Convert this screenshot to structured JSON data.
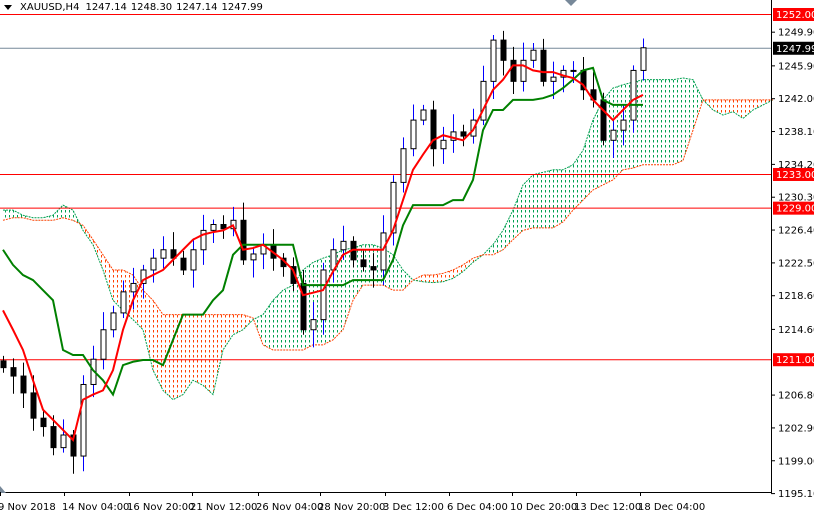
{
  "header": {
    "symbol": "XAUUSD,H4",
    "open": "1247.14",
    "high": "1248.30",
    "low": "1247.14",
    "close": "1247.99"
  },
  "colors": {
    "level": "#ff0000",
    "tenkan": "#ff0000",
    "kijun": "#008000",
    "cloud_bull": "#00a050",
    "cloud_bear": "#ff4000",
    "bid_line": "#778899",
    "bid_label": "#000000",
    "wick_up": "#0000ff"
  },
  "chart_data": {
    "type": "candlestick",
    "title": "XAUUSD,H4",
    "ylim": [
      1195.1,
      1254.0
    ],
    "yticks": [
      "1249.90",
      "1245.90",
      "1242.00",
      "1238.10",
      "1234.20",
      "1230.30",
      "1226.40",
      "1222.50",
      "1218.60",
      "1214.60",
      "1206.80",
      "1202.90",
      "1199.00",
      "1195.10"
    ],
    "xticks": [
      "9 Nov 2018",
      "14 Nov 04:00",
      "16 Nov 20:00",
      "21 Nov 12:00",
      "26 Nov 04:00",
      "28 Nov 20:00",
      "3 Dec 12:00",
      "6 Dec 04:00",
      "10 Dec 20:00",
      "13 Dec 12:00",
      "18 Dec 04:00"
    ],
    "levels": [
      {
        "price": 1252.0,
        "label": "1252.00"
      },
      {
        "price": 1233.0,
        "label": "1233.00"
      },
      {
        "price": 1229.0,
        "label": "1229.00"
      },
      {
        "price": 1211.0,
        "label": "1211.00"
      }
    ],
    "bid": {
      "price": 1247.99,
      "label": "1247.99"
    },
    "close": [
      1210,
      1209,
      1207,
      1204,
      1203,
      1200.5,
      1202,
      1199.5,
      1208,
      1211,
      1214.5,
      1216.5,
      1219,
      1220,
      1221.6,
      1223,
      1224,
      1223,
      1221.6,
      1224,
      1226.3,
      1227,
      1226.5,
      1227.5,
      1222.8,
      1223.5,
      1224.6,
      1223,
      1222,
      1220,
      1214.5,
      1215.7,
      1221.6,
      1224,
      1225,
      1222.8,
      1222,
      1221.6,
      1226,
      1232,
      1236,
      1239.4,
      1240.6,
      1236,
      1237,
      1238,
      1237.5,
      1239.4,
      1244,
      1248.9,
      1246.5,
      1244,
      1246.5,
      1247.7,
      1244,
      1244.5,
      1245.3,
      1245.3,
      1243,
      1241.8,
      1237,
      1238.2,
      1239.4,
      1245.3,
      1247.99
    ],
    "tenkan": [
      1216.8,
      1214.5,
      1212.1,
      1208.5,
      1205,
      1203.8,
      1202.6,
      1201.4,
      1206.2,
      1206.8,
      1207.3,
      1209.7,
      1214.5,
      1218,
      1220.4,
      1221,
      1221.6,
      1222.8,
      1224,
      1225.2,
      1225.8,
      1226.1,
      1226.3,
      1226.9,
      1224,
      1224.2,
      1224.6,
      1223.7,
      1222.8,
      1221.6,
      1218.6,
      1218.9,
      1219.2,
      1221.4,
      1223.4,
      1224,
      1224,
      1224,
      1224,
      1226.3,
      1229.9,
      1233.5,
      1235.3,
      1237,
      1237.6,
      1237.3,
      1237,
      1238.2,
      1240.6,
      1243,
      1244.2,
      1245.9,
      1245.9,
      1245.3,
      1245.1,
      1245.1,
      1244.7,
      1244.4,
      1243.6,
      1241.8,
      1240.6,
      1239.4,
      1240.6,
      1241.8,
      1242.4
    ],
    "kijun": [
      1224,
      1222.2,
      1221,
      1220.4,
      1219.2,
      1218,
      1212.1,
      1211.5,
      1211.5,
      1209.7,
      1208.5,
      1206.8,
      1210.3,
      1210.7,
      1210.9,
      1210.9,
      1210.3,
      1213.3,
      1216.3,
      1216.3,
      1216.3,
      1218,
      1219.2,
      1223.4,
      1224.6,
      1224.6,
      1224.6,
      1224.6,
      1224.6,
      1224.6,
      1219.8,
      1219.8,
      1219.8,
      1219.8,
      1219.8,
      1220.4,
      1220.4,
      1220.4,
      1220.4,
      1222.8,
      1226.9,
      1229.3,
      1229.3,
      1229.3,
      1229.3,
      1229.9,
      1229.9,
      1232.3,
      1238.2,
      1240.6,
      1240.6,
      1241.8,
      1241.8,
      1241.8,
      1242,
      1242.4,
      1243.2,
      1244.2,
      1245.3,
      1245.6,
      1241.8,
      1241.2,
      1241.2,
      1241.2,
      1241.2
    ],
    "span_a": [
      1228.7,
      1228.7,
      1228.1,
      1227.8,
      1227.8,
      1228.1,
      1229.3,
      1228.7,
      1226.3,
      1224.6,
      1221.6,
      1218.0,
      1216.8,
      1215.7,
      1214.5,
      1209.7,
      1207.3,
      1206.2,
      1206.8,
      1208.5,
      1207.9,
      1206.8,
      1212.1,
      1213.9,
      1214.5,
      1215.7,
      1216.3,
      1218.0,
      1219.2,
      1219.8,
      1221.6,
      1222.5,
      1223.0,
      1223.4,
      1224.0,
      1224.2,
      1224.6,
      1224.6,
      1224.2,
      1223.4,
      1221.6,
      1220.4,
      1220.2,
      1220.1,
      1220.2,
      1220.6,
      1221.4,
      1222.5,
      1223.4,
      1224.6,
      1226.3,
      1228.7,
      1231.7,
      1232.9,
      1233.2,
      1233.5,
      1233.5,
      1234.1,
      1235.8,
      1239.4,
      1241.8,
      1243.2,
      1243.6,
      1243.9,
      1244.2,
      1244.2,
      1244.2,
      1244.2,
      1244.4,
      1244.2,
      1241.8,
      1240.6,
      1240.0,
      1240.4,
      1239.6,
      1240.6,
      1241.2,
      1241.8
    ],
    "span_b": [
      1227.5,
      1227.8,
      1227.8,
      1227.5,
      1227.5,
      1227.5,
      1227.8,
      1227.5,
      1226.9,
      1225.2,
      1223.4,
      1221.6,
      1221.6,
      1221.0,
      1219.2,
      1218.0,
      1216.3,
      1216.3,
      1216.3,
      1216.3,
      1216.3,
      1216.3,
      1216.3,
      1216.3,
      1216.3,
      1215.9,
      1212.7,
      1212.1,
      1212.1,
      1212.1,
      1212.1,
      1212.7,
      1212.7,
      1213.3,
      1214.5,
      1218.0,
      1219.8,
      1219.8,
      1219.8,
      1219.2,
      1219.2,
      1220.4,
      1221.0,
      1221.0,
      1221.2,
      1221.6,
      1222.2,
      1223.0,
      1223.4,
      1223.4,
      1224.0,
      1225.2,
      1226.3,
      1226.6,
      1226.6,
      1226.6,
      1227.3,
      1228.7,
      1229.9,
      1231.1,
      1231.7,
      1232.3,
      1233.5,
      1233.7,
      1234.1,
      1234.1,
      1234.1,
      1234.1,
      1234.6,
      1238.2,
      1241.8,
      1241.8,
      1241.8,
      1241.8,
      1241.8,
      1241.8,
      1241.8,
      1241.8
    ]
  }
}
